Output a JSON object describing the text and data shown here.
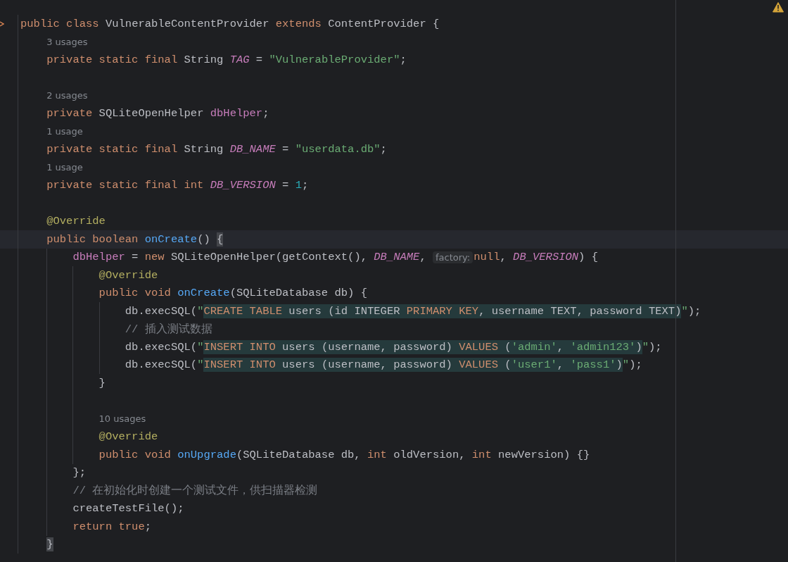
{
  "editor": {
    "warning": true,
    "lines": [
      {
        "kind": "code",
        "gutter_mark": true,
        "tokens": [
          {
            "text": "public class ",
            "kind": "keyword"
          },
          {
            "text": "VulnerableContentProvider ",
            "kind": "plain"
          },
          {
            "text": "extends ",
            "kind": "keyword"
          },
          {
            "text": "ContentProvider {",
            "kind": "plain"
          }
        ],
        "children": [
          {
            "kind": "hint",
            "text": "3 usages"
          },
          {
            "kind": "code",
            "tokens": [
              {
                "text": "private static final ",
                "kind": "keyword"
              },
              {
                "text": "String ",
                "kind": "plain"
              },
              {
                "text": "TAG",
                "kind": "constant"
              },
              {
                "text": " = ",
                "kind": "plain"
              },
              {
                "text": "\"VulnerableProvider\"",
                "kind": "string"
              },
              {
                "text": ";",
                "kind": "plain"
              }
            ]
          },
          {
            "kind": "blank"
          },
          {
            "kind": "hint",
            "text": "2 usages"
          },
          {
            "kind": "code",
            "tokens": [
              {
                "text": "private ",
                "kind": "keyword"
              },
              {
                "text": "SQLiteOpenHelper ",
                "kind": "plain"
              },
              {
                "text": "dbHelper",
                "kind": "field"
              },
              {
                "text": ";",
                "kind": "plain"
              }
            ]
          },
          {
            "kind": "hint",
            "text": "1 usage"
          },
          {
            "kind": "code",
            "tokens": [
              {
                "text": "private static final ",
                "kind": "keyword"
              },
              {
                "text": "String ",
                "kind": "plain"
              },
              {
                "text": "DB_NAME",
                "kind": "constant"
              },
              {
                "text": " = ",
                "kind": "plain"
              },
              {
                "text": "\"userdata.db\"",
                "kind": "string"
              },
              {
                "text": ";",
                "kind": "plain"
              }
            ]
          },
          {
            "kind": "hint",
            "text": "1 usage"
          },
          {
            "kind": "code",
            "tokens": [
              {
                "text": "private static final int ",
                "kind": "keyword"
              },
              {
                "text": "DB_VERSION",
                "kind": "constant"
              },
              {
                "text": " = ",
                "kind": "plain"
              },
              {
                "text": "1",
                "kind": "number"
              },
              {
                "text": ";",
                "kind": "plain"
              }
            ]
          },
          {
            "kind": "blank"
          },
          {
            "kind": "code",
            "tokens": [
              {
                "text": "@Override",
                "kind": "annotation"
              }
            ]
          },
          {
            "kind": "code",
            "current": true,
            "tokens": [
              {
                "text": "public boolean ",
                "kind": "keyword"
              },
              {
                "text": "onCreate",
                "kind": "method"
              },
              {
                "text": "() ",
                "kind": "plain"
              },
              {
                "text": "{",
                "kind": "brace",
                "matched": true
              }
            ],
            "children": [
              {
                "kind": "code",
                "tokens": [
                  {
                    "text": "dbHelper",
                    "kind": "field"
                  },
                  {
                    "text": " = ",
                    "kind": "plain"
                  },
                  {
                    "text": "new ",
                    "kind": "keyword"
                  },
                  {
                    "text": "SQLiteOpenHelper(getContext(), ",
                    "kind": "plain"
                  },
                  {
                    "text": "DB_NAME",
                    "kind": "constant"
                  },
                  {
                    "text": ", ",
                    "kind": "plain"
                  },
                  {
                    "text": "factory:",
                    "kind": "inlay"
                  },
                  {
                    "text": "null",
                    "kind": "keyword"
                  },
                  {
                    "text": ", ",
                    "kind": "plain"
                  },
                  {
                    "text": "DB_VERSION",
                    "kind": "constant"
                  },
                  {
                    "text": ") {",
                    "kind": "plain"
                  }
                ],
                "children": [
                  {
                    "kind": "code",
                    "tokens": [
                      {
                        "text": "@Override",
                        "kind": "annotation"
                      }
                    ]
                  },
                  {
                    "kind": "code",
                    "tokens": [
                      {
                        "text": "public void ",
                        "kind": "keyword"
                      },
                      {
                        "text": "onCreate",
                        "kind": "method"
                      },
                      {
                        "text": "(SQLiteDatabase db) {",
                        "kind": "plain"
                      }
                    ],
                    "children": [
                      {
                        "kind": "code",
                        "tokens": [
                          {
                            "text": "db.execSQL(",
                            "kind": "plain"
                          },
                          {
                            "text": "\"",
                            "kind": "string"
                          },
                          {
                            "text": "CREATE TABLE",
                            "kind": "sql-keyword"
                          },
                          {
                            "text": " users (id INTEGER ",
                            "kind": "sql"
                          },
                          {
                            "text": "PRIMARY KEY",
                            "kind": "sql-keyword"
                          },
                          {
                            "text": ", username TEXT, password TEXT)",
                            "kind": "sql"
                          },
                          {
                            "text": "\"",
                            "kind": "string"
                          },
                          {
                            "text": ");",
                            "kind": "plain"
                          }
                        ]
                      },
                      {
                        "kind": "code",
                        "tokens": [
                          {
                            "text": "// 插入测试数据",
                            "kind": "comment"
                          }
                        ]
                      },
                      {
                        "kind": "code",
                        "tokens": [
                          {
                            "text": "db.execSQL(",
                            "kind": "plain"
                          },
                          {
                            "text": "\"",
                            "kind": "string"
                          },
                          {
                            "text": "INSERT INTO",
                            "kind": "sql-keyword"
                          },
                          {
                            "text": " users (username, password) ",
                            "kind": "sql"
                          },
                          {
                            "text": "VALUES",
                            "kind": "sql-keyword"
                          },
                          {
                            "text": " (",
                            "kind": "sql"
                          },
                          {
                            "text": "'admin'",
                            "kind": "sql-string"
                          },
                          {
                            "text": ", ",
                            "kind": "sql"
                          },
                          {
                            "text": "'admin123'",
                            "kind": "sql-string"
                          },
                          {
                            "text": ")",
                            "kind": "sql"
                          },
                          {
                            "text": "\"",
                            "kind": "string"
                          },
                          {
                            "text": ");",
                            "kind": "plain"
                          }
                        ]
                      },
                      {
                        "kind": "code",
                        "tokens": [
                          {
                            "text": "db.execSQL(",
                            "kind": "plain"
                          },
                          {
                            "text": "\"",
                            "kind": "string"
                          },
                          {
                            "text": "INSERT INTO",
                            "kind": "sql-keyword"
                          },
                          {
                            "text": " users (username, password) ",
                            "kind": "sql"
                          },
                          {
                            "text": "VALUES",
                            "kind": "sql-keyword"
                          },
                          {
                            "text": " (",
                            "kind": "sql"
                          },
                          {
                            "text": "'user1'",
                            "kind": "sql-string"
                          },
                          {
                            "text": ", ",
                            "kind": "sql"
                          },
                          {
                            "text": "'pass1'",
                            "kind": "sql-string"
                          },
                          {
                            "text": ")",
                            "kind": "sql"
                          },
                          {
                            "text": "\"",
                            "kind": "string"
                          },
                          {
                            "text": ");",
                            "kind": "plain"
                          }
                        ]
                      }
                    ]
                  },
                  {
                    "kind": "code",
                    "tokens": [
                      {
                        "text": "}",
                        "kind": "plain"
                      }
                    ]
                  },
                  {
                    "kind": "blank"
                  },
                  {
                    "kind": "hint",
                    "text": "10 usages"
                  },
                  {
                    "kind": "code",
                    "tokens": [
                      {
                        "text": "@Override",
                        "kind": "annotation"
                      }
                    ]
                  },
                  {
                    "kind": "code",
                    "tokens": [
                      {
                        "text": "public void ",
                        "kind": "keyword"
                      },
                      {
                        "text": "onUpgrade",
                        "kind": "method"
                      },
                      {
                        "text": "(SQLiteDatabase db, ",
                        "kind": "plain"
                      },
                      {
                        "text": "int ",
                        "kind": "keyword"
                      },
                      {
                        "text": "oldVersion, ",
                        "kind": "plain"
                      },
                      {
                        "text": "int ",
                        "kind": "keyword"
                      },
                      {
                        "text": "newVersion) {}",
                        "kind": "plain"
                      }
                    ]
                  }
                ]
              },
              {
                "kind": "code",
                "tokens": [
                  {
                    "text": "};",
                    "kind": "plain"
                  }
                ]
              },
              {
                "kind": "code",
                "tokens": [
                  {
                    "text": "// 在初始化时创建一个测试文件，供扫描器检测",
                    "kind": "comment"
                  }
                ]
              },
              {
                "kind": "code",
                "tokens": [
                  {
                    "text": "createTestFile();",
                    "kind": "plain"
                  }
                ]
              },
              {
                "kind": "code",
                "tokens": [
                  {
                    "text": "return true",
                    "kind": "keyword"
                  },
                  {
                    "text": ";",
                    "kind": "plain"
                  }
                ]
              }
            ]
          },
          {
            "kind": "code",
            "tokens": [
              {
                "text": "}",
                "kind": "brace",
                "matched": true
              }
            ]
          }
        ]
      }
    ]
  }
}
